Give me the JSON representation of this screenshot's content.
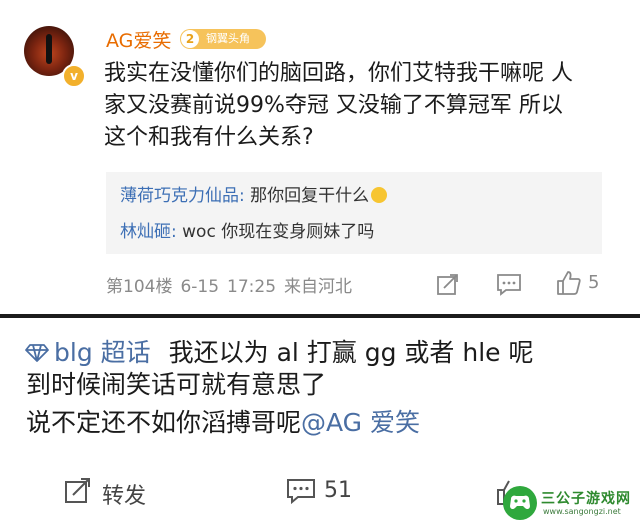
{
  "comment": {
    "username": "AG爱笑",
    "level": "2",
    "badge_label": "钢翼头角",
    "verified_mark": "v",
    "text_lines": [
      "我实在没懂你们的脑回路，你们艾特我干嘛呢 人",
      "家又没赛前说99%夺冠 又没输了不算冠军 所以",
      "这个和我有什么关系?"
    ],
    "replies": [
      {
        "name": "薄荷巧克力仙品:",
        "text": " 那你回复干什么",
        "emoji": "grin-emoji"
      },
      {
        "name": "林灿砸:",
        "text": " woc 你现在变身厕妹了吗"
      }
    ],
    "floor": "第104楼",
    "date": "6-15",
    "time": "17:25",
    "location": "来自河北",
    "like_count": "5"
  },
  "post": {
    "topic": "blg 超话",
    "lines": [
      "我还以为 al 打赢 gg 或者 hle 呢",
      "到时候闹笑话可就有意思了",
      "说不定还不如你滔搏哥呢"
    ],
    "mention": "@AG 爱笑",
    "share_label": "转发",
    "comment_count": "51"
  },
  "watermark": {
    "title": "三公子游戏网",
    "url": "www.sangongzi.net"
  },
  "colors": {
    "username": "#e86c00",
    "reply_name": "#3d6fb5",
    "topic": "#4a6ea3",
    "meta": "#8a8a8a"
  }
}
